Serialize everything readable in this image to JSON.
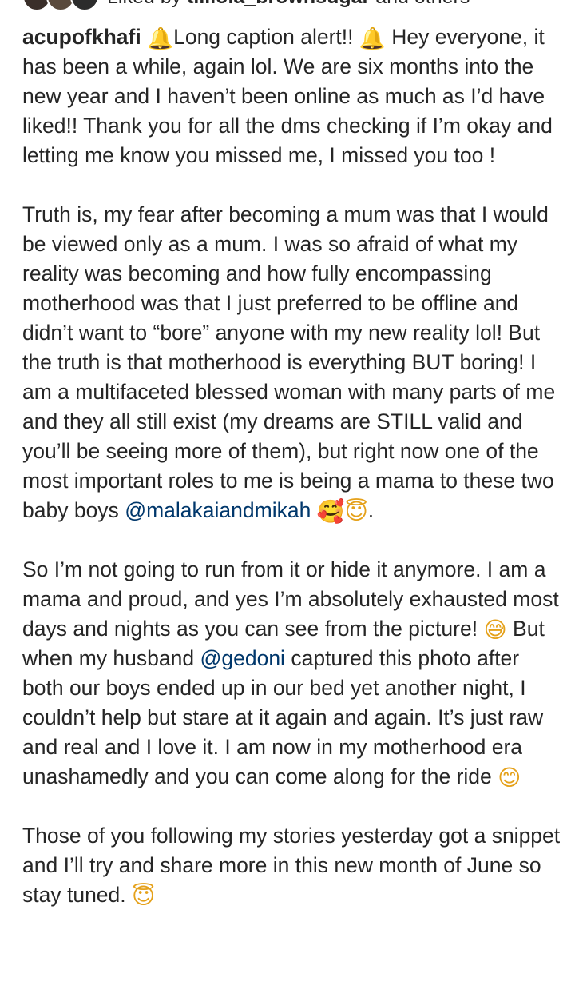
{
  "liked_by": {
    "prefix": "Liked by",
    "user": "tilliola_brownsugar",
    "suffix": "and others"
  },
  "caption": {
    "username": "acupofkhafi",
    "p1": {
      "emoji_bell": "🔔",
      "t1": "Long caption alert!!",
      "t2": "Hey everyone, it has been a while, again lol. We are six months into the new year and I haven’t been online as much as I’d have liked!! Thank you for all the dms checking if I’m okay and letting me know you missed me, I missed you too !"
    },
    "p2": {
      "text": "Truth is, my fear after becoming a mum was that I would be viewed only as a mum. I was so afraid of what my reality was becoming and how fully encompassing motherhood was that I just preferred to be offline and didn’t want to “bore” anyone with my new reality lol!  But the truth is that motherhood is everything BUT boring! I am a multifaceted blessed woman with many parts of me and they all still exist (my dreams are STILL valid and you’ll be seeing more of them), but right now one of the most important roles to me is being a mama to these two baby boys",
      "mention": "@malakaiandmikah",
      "emoji_hearts": "🥰",
      "emoji_angel": "😇",
      "end": "."
    },
    "p3": {
      "t1": "So I’m not going to run from it or hide it anymore. I am a mama and proud, and yes I’m absolutely exhausted most days and nights as you can see from the picture!",
      "emoji_sweat": "😅",
      "t2": "But when my husband",
      "mention": "@gedoni",
      "t3": "captured this photo after both our boys ended up in our bed yet another night,  I couldn’t help but stare at it again and again. It’s just raw and real and I love it.  I am now in my motherhood era unashamedly and you can come along for the ride",
      "emoji_smile": "😊"
    },
    "p4": {
      "text": "Those of you following my stories yesterday got a snippet and I’ll try and share more in this new month of June so stay tuned.",
      "emoji_angel": "😇"
    }
  },
  "colors": {
    "text": "#262626",
    "mention": "#00376b",
    "background": "#ffffff"
  }
}
